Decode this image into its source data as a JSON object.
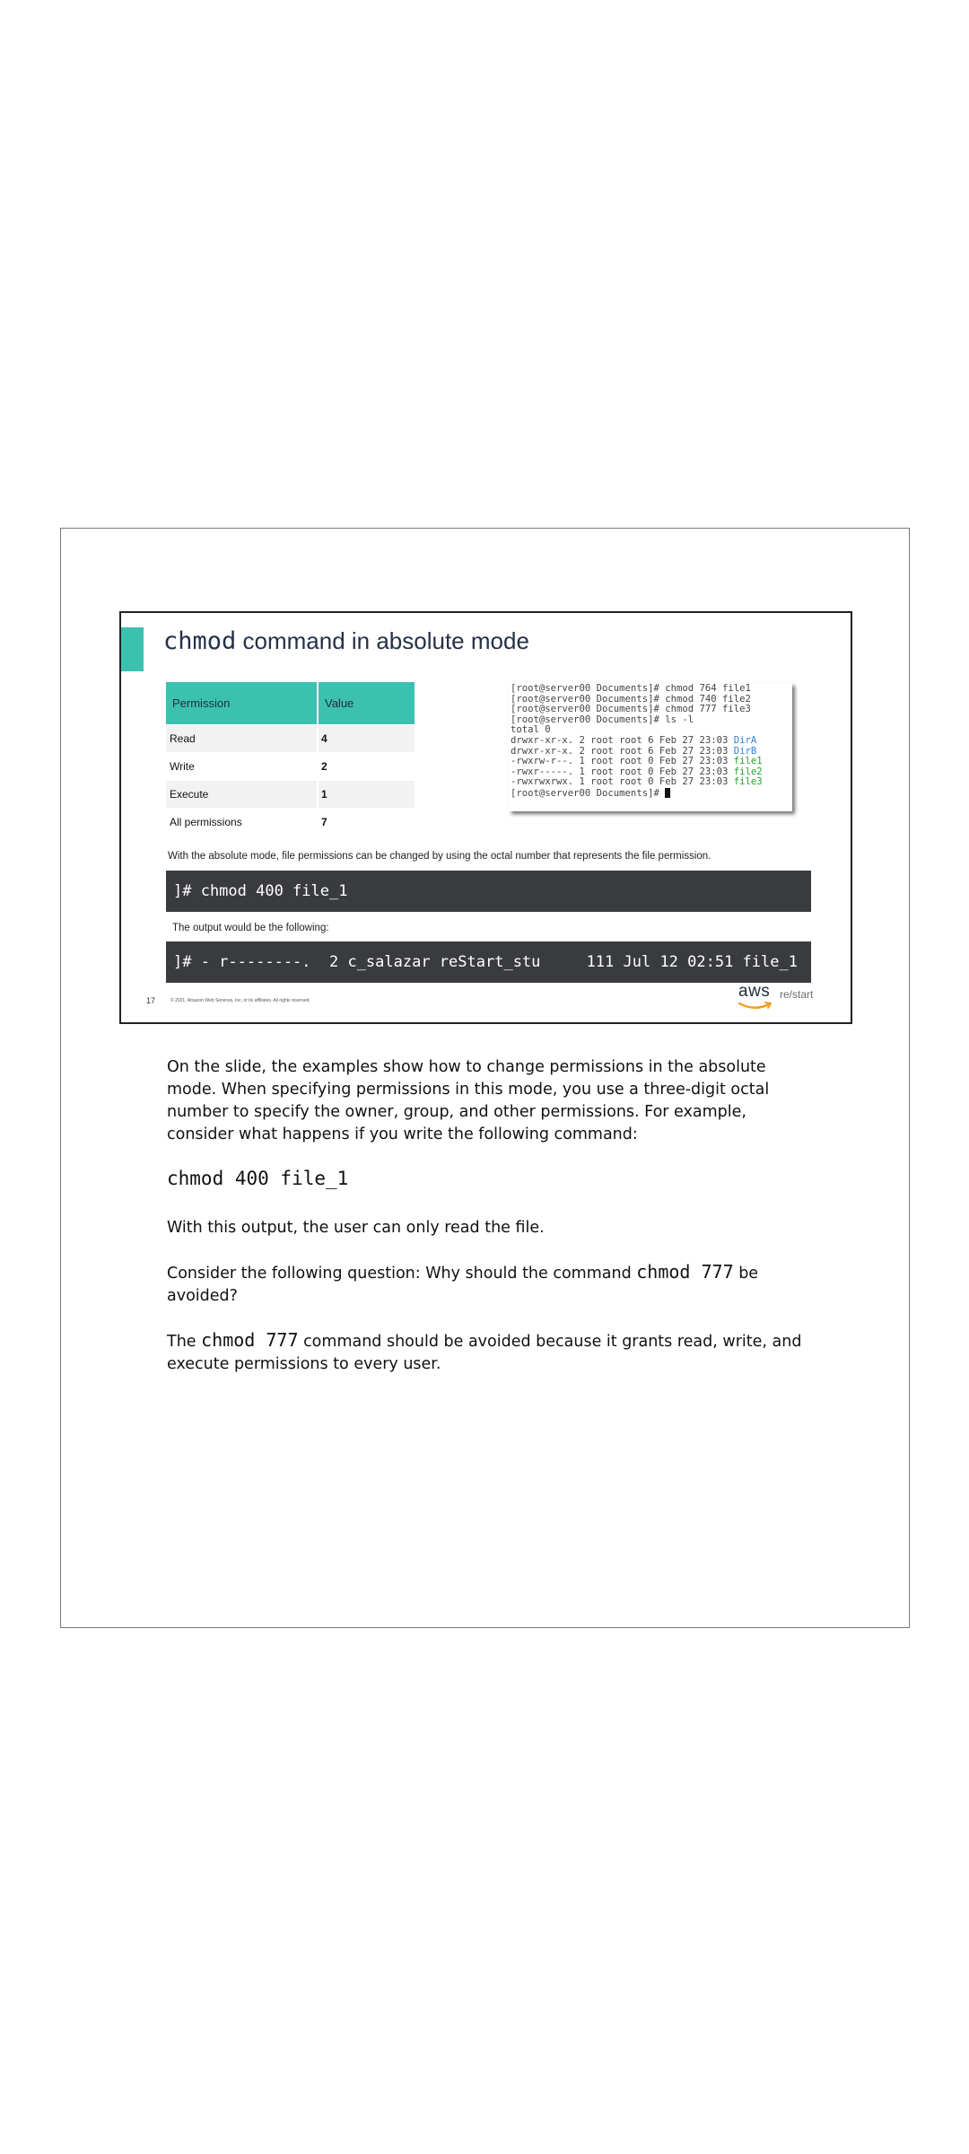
{
  "slide": {
    "title_mono": "chmod",
    "title_rest": " command in absolute mode",
    "table": {
      "headers": [
        "Permission",
        "Value"
      ],
      "rows": [
        {
          "permission": "Read",
          "value": "4"
        },
        {
          "permission": "Write",
          "value": "2"
        },
        {
          "permission": "Execute",
          "value": "1"
        },
        {
          "permission": "All permissions",
          "value": "7"
        }
      ]
    },
    "terminal": {
      "lines": [
        "[root@server00 Documents]# chmod 764 file1",
        "[root@server00 Documents]# chmod 740 file2",
        "[root@server00 Documents]# chmod 777 file3",
        "[root@server00 Documents]# ls -l",
        "total 0"
      ],
      "listing": [
        {
          "prefix": "drwxr-xr-x. 2 root root 6 Feb 27 23:03 ",
          "name": "DirA",
          "kind": "dir"
        },
        {
          "prefix": "drwxr-xr-x. 2 root root 6 Feb 27 23:03 ",
          "name": "DirB",
          "kind": "dir"
        },
        {
          "prefix": "-rwxrw-r--. 1 root root 0 Feb 27 23:03 ",
          "name": "file1",
          "kind": "file"
        },
        {
          "prefix": "-rwxr-----. 1 root root 0 Feb 27 23:03 ",
          "name": "file2",
          "kind": "file"
        },
        {
          "prefix": "-rwxrwxrwx. 1 root root 0 Feb 27 23:03 ",
          "name": "file3",
          "kind": "file"
        }
      ],
      "prompt": "[root@server00 Documents]# "
    },
    "intro_text": "With the absolute mode, file permissions can be changed by using the octal number that represents the file permission.",
    "command": "]# chmod 400 file_1",
    "output_label": "The output would be the following:",
    "output": "]# - r--------.  2 c_salazar reStart_stu     111 Jul 12 02:51 file_1",
    "slide_number": "17",
    "copyright": "© 2021, Amazon Web Services, Inc. or its affiliates. All rights reserved.",
    "logo_text": "aws",
    "brand_text": "re/start",
    "colors": {
      "accent": "#3cc1b1",
      "code_bg": "#3a3b3f",
      "dir": "#2f7fd6",
      "file": "#21a32a"
    }
  },
  "notes": {
    "p1": "On the slide, the examples show how to change permissions in the absolute mode. When specifying permissions in this mode, you use a three-digit octal number to specify the owner, group, and other permissions. For example, consider what happens if you write the following command:",
    "code": "chmod 400 file_1",
    "p2": "With this output, the user can only read the file.",
    "p3_before": "Consider the following question: Why should the command ",
    "p3_code": "chmod 777",
    "p3_after": " be avoided?",
    "p4_before": "The ",
    "p4_code": "chmod 777",
    "p4_after": " command should be avoided because it grants read, write, and execute permissions to every user."
  }
}
